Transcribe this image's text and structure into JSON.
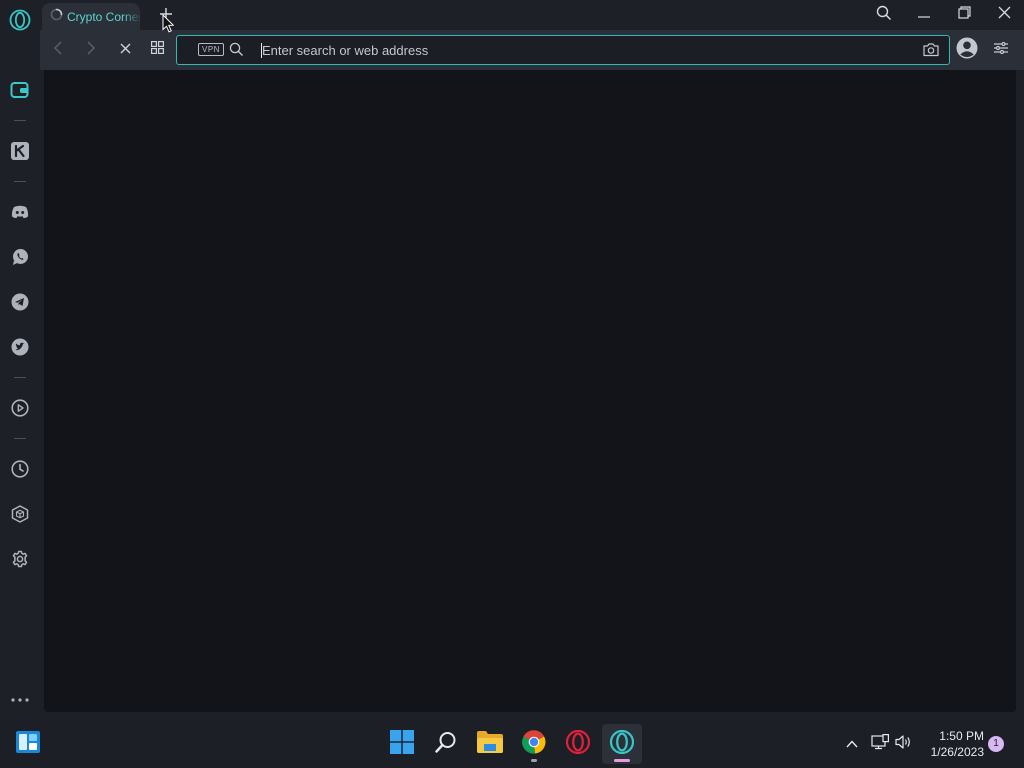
{
  "browser": {
    "tab": {
      "title": "Crypto Corner"
    },
    "address_bar": {
      "vpn_badge": "VPN",
      "placeholder": "Enter search or web address",
      "value": ""
    }
  },
  "sidebar": {
    "items": [
      {
        "name": "wallet",
        "icon": "wallet-icon"
      },
      {
        "name": "kucoin",
        "icon": "k-icon"
      },
      {
        "name": "discord",
        "icon": "discord-icon"
      },
      {
        "name": "whatsapp",
        "icon": "whatsapp-icon"
      },
      {
        "name": "telegram",
        "icon": "telegram-icon"
      },
      {
        "name": "twitter",
        "icon": "twitter-icon"
      },
      {
        "name": "player",
        "icon": "play-icon"
      },
      {
        "name": "history",
        "icon": "clock-icon"
      },
      {
        "name": "extensions",
        "icon": "cube-icon"
      },
      {
        "name": "settings",
        "icon": "gear-icon"
      },
      {
        "name": "more",
        "icon": "ellipsis-icon"
      }
    ]
  },
  "taskbar": {
    "clock": {
      "time": "1:50 PM",
      "date": "1/26/2023"
    },
    "notification_count": "1"
  },
  "colors": {
    "accent": "#38b6b6",
    "page_bg": "#121419",
    "chrome_bg": "#2b2f37"
  }
}
